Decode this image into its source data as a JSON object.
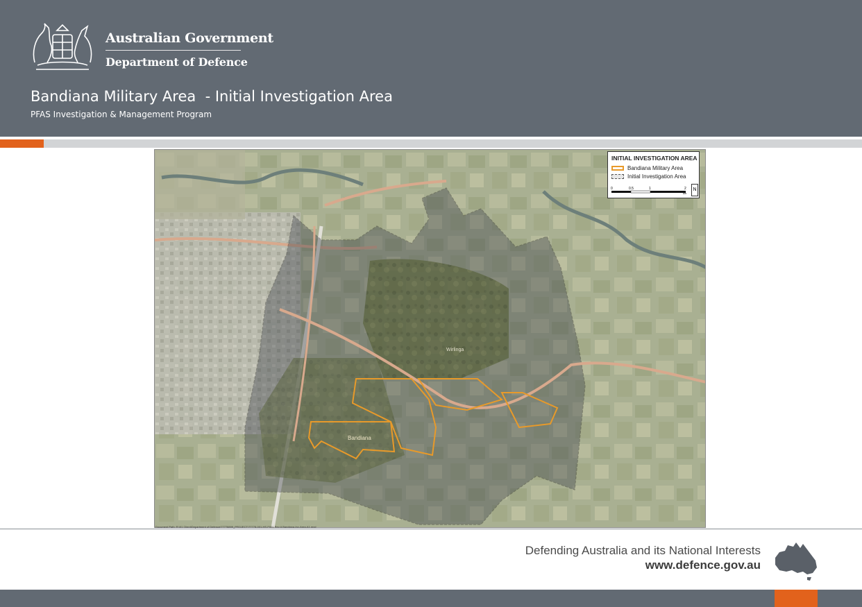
{
  "header": {
    "government": "Australian Government",
    "department": "Department of Defence",
    "title": "Bandiana Military Area  - Initial Investigation Area",
    "subtitle": "PFAS Investigation & Management Program"
  },
  "legend": {
    "title": "INITIAL INVESTIGATION AREA",
    "items": [
      {
        "label": "Bandiana Military Area",
        "color": "#e89a2a"
      },
      {
        "label": "Initial Investigation Area",
        "color": "#555555"
      }
    ],
    "scale_labels": [
      "0",
      "0.5",
      "1",
      "2"
    ],
    "scale_unit": "km",
    "north": "N"
  },
  "map": {
    "labels": {
      "bandiana": "Bandiana",
      "wirlinga": "Wirlinga"
    },
    "footer_path": "Document Path: R:\\01 Client\\Department of Defence\\77778899_PROJECT\\77778-001-HS-F001 Rev A Bandiana-Inv-Area-A1.mxd"
  },
  "footer": {
    "tagline": "Defending Australia and its National Interests",
    "website": "www.defence.gov.au"
  },
  "colors": {
    "header": "#626a73",
    "accent": "#e2621c",
    "boundary": "#e89a2a"
  }
}
